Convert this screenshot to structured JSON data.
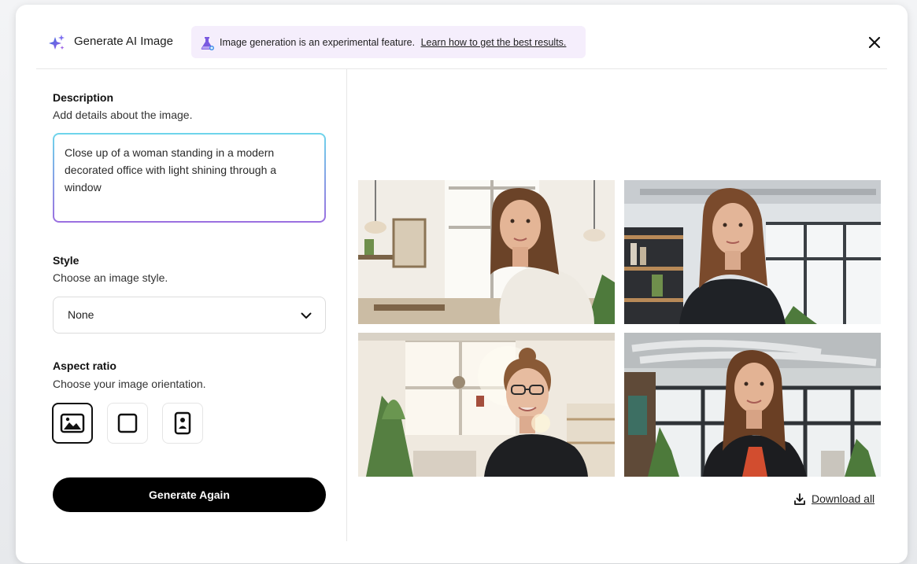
{
  "dialog": {
    "title": "Generate AI Image",
    "banner_text": "Image generation is an experimental feature.",
    "banner_link": "Learn how to get the best results.",
    "accent_color": "#9b6fe0"
  },
  "description": {
    "title": "Description",
    "subtitle": "Add details about the image.",
    "value": "Close up of a woman standing in a modern decorated office with light shining through a window"
  },
  "style": {
    "title": "Style",
    "subtitle": "Choose an image style.",
    "selected": "None"
  },
  "aspect": {
    "title": "Aspect ratio",
    "subtitle": "Choose your image orientation.",
    "options": [
      {
        "icon": "landscape-image-icon",
        "selected": true
      },
      {
        "icon": "square-icon",
        "selected": false
      },
      {
        "icon": "portrait-icon",
        "selected": false
      }
    ]
  },
  "actions": {
    "generate_label": "Generate Again",
    "download_all_label": "Download all"
  },
  "results": {
    "image_count": 4
  }
}
